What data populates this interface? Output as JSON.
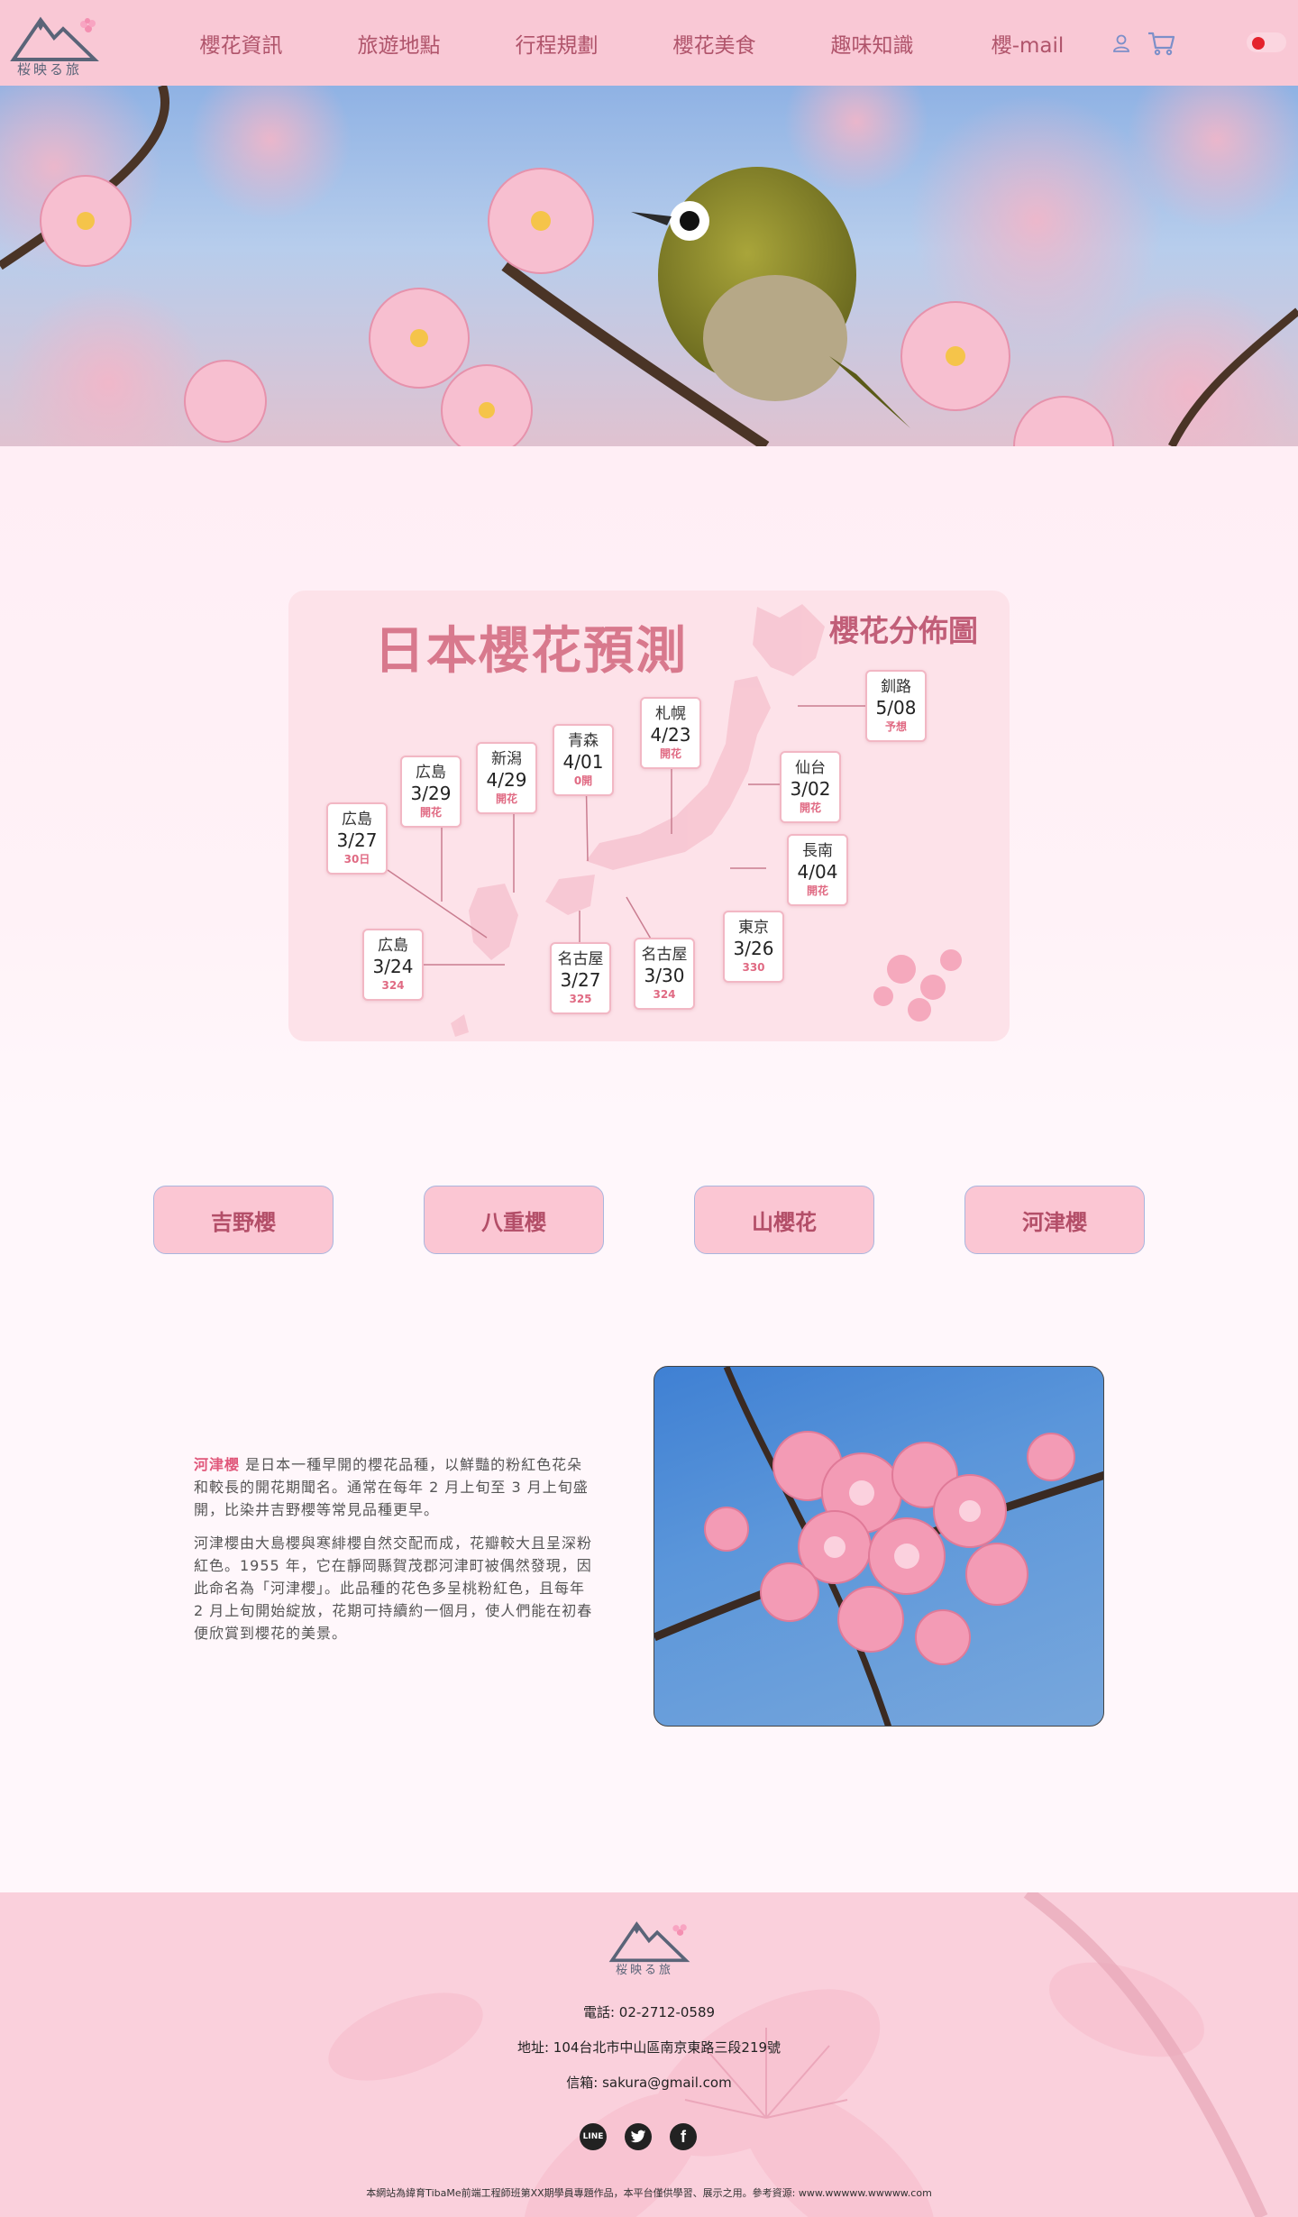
{
  "header": {
    "logo_text": "桜映る旅",
    "nav": [
      "櫻花資訊",
      "旅遊地點",
      "行程規劃",
      "櫻花美食",
      "趣味知識",
      "櫻-mail"
    ],
    "icons": [
      "user-icon",
      "cart-icon"
    ],
    "theme_toggle_color": "#e4222c"
  },
  "hero": {
    "image": "cherry-blossom-bird-photo"
  },
  "map": {
    "title": "日本櫻花預測",
    "subtitle": "櫻花分佈圖",
    "cities": [
      {
        "name": "札幌",
        "date": "4/23",
        "note": "開花"
      },
      {
        "name": "釧路",
        "date": "5/08",
        "note": "予想"
      },
      {
        "name": "青森",
        "date": "4/01",
        "note": "0開"
      },
      {
        "name": "新潟",
        "date": "4/29",
        "note": "開花"
      },
      {
        "name": "仙台",
        "date": "3/02",
        "note": "開花"
      },
      {
        "name": "広島",
        "date": "3/29",
        "note": "開花"
      },
      {
        "name": "広島",
        "date": "3/27",
        "note": "30日"
      },
      {
        "name": "長南",
        "date": "4/04",
        "note": "開花"
      },
      {
        "name": "東京",
        "date": "3/26",
        "note": "330"
      },
      {
        "name": "広島",
        "date": "3/24",
        "note": "324"
      },
      {
        "name": "名古屋",
        "date": "3/27",
        "note": "325"
      },
      {
        "name": "名古屋",
        "date": "3/30",
        "note": "324"
      }
    ]
  },
  "varieties": [
    "吉野櫻",
    "八重櫻",
    "山櫻花",
    "河津櫻"
  ],
  "description": {
    "highlight": "河津櫻",
    "p1_rest": " 是日本一種早開的櫻花品種，以鮮豔的粉紅色花朵和較長的開花期聞名。通常在每年 2 月上旬至 3 月上旬盛開，比染井吉野櫻等常見品種更早。",
    "p2": "河津櫻由大島櫻與寒緋櫻自然交配而成，花瓣較大且呈深粉紅色。1955 年，它在靜岡縣賀茂郡河津町被偶然發現，因此命名為「河津櫻」。此品種的花色多呈桃粉紅色，且每年 2 月上旬開始綻放，花期可持續約一個月，使人們能在初春便欣賞到櫻花的美景。"
  },
  "footer": {
    "logo_text": "桜映る旅",
    "phone": "電話: 02-2712-0589",
    "address": "地址: 104台北市中山區南京東路三段219號",
    "email": "信箱: sakura@gmail.com",
    "socials": [
      "LINE",
      "twitter-icon",
      "facebook-icon"
    ],
    "copyright": "本網站為緯育TibaMe前端工程師班第XX期學員專題作品，本平台僅供學習、展示之用。參考資源: www.wwwww.wwwww.com"
  }
}
